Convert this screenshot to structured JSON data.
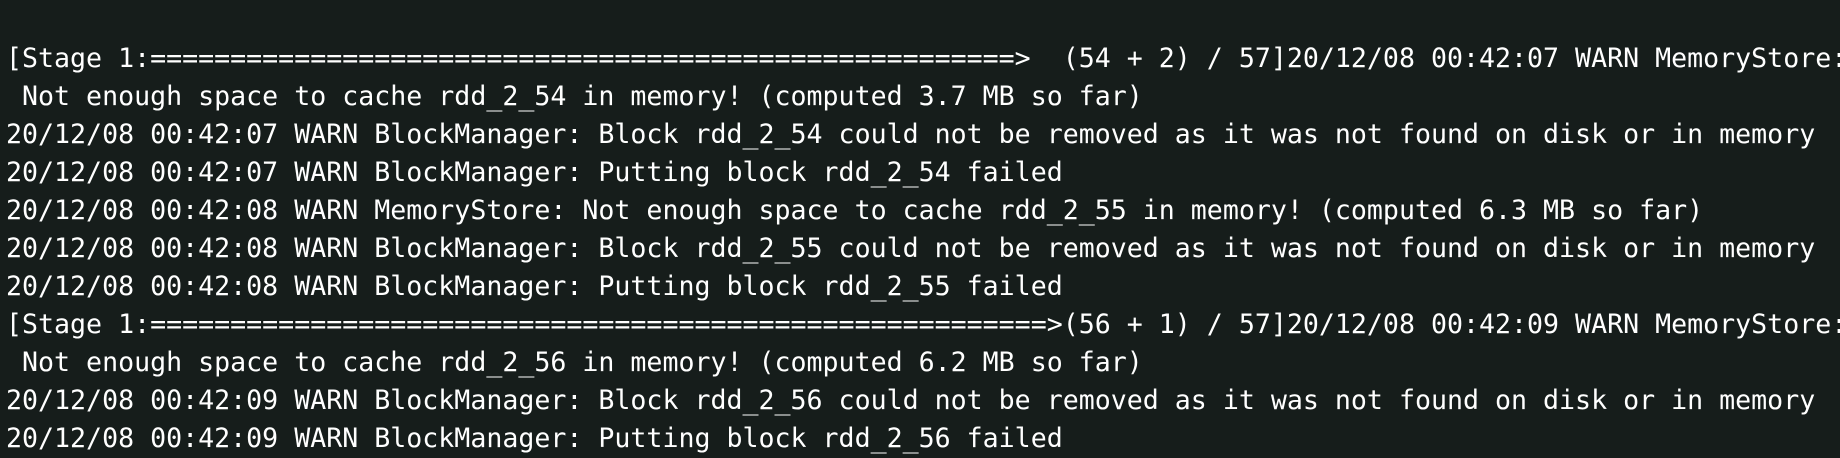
{
  "terminal": {
    "background": "#161d1b",
    "foreground": "#ffffff",
    "lines": [
      "[Stage 1:======================================================>  (54 + 2) / 57]20/12/08 00:42:07 WARN MemoryStore:",
      " Not enough space to cache rdd_2_54 in memory! (computed 3.7 MB so far)",
      "20/12/08 00:42:07 WARN BlockManager: Block rdd_2_54 could not be removed as it was not found on disk or in memory",
      "20/12/08 00:42:07 WARN BlockManager: Putting block rdd_2_54 failed",
      "20/12/08 00:42:08 WARN MemoryStore: Not enough space to cache rdd_2_55 in memory! (computed 6.3 MB so far)",
      "20/12/08 00:42:08 WARN BlockManager: Block rdd_2_55 could not be removed as it was not found on disk or in memory",
      "20/12/08 00:42:08 WARN BlockManager: Putting block rdd_2_55 failed",
      "[Stage 1:========================================================>(56 + 1) / 57]20/12/08 00:42:09 WARN MemoryStore:",
      " Not enough space to cache rdd_2_56 in memory! (computed 6.2 MB so far)",
      "20/12/08 00:42:09 WARN BlockManager: Block rdd_2_56 could not be removed as it was not found on disk or in memory",
      "20/12/08 00:42:09 WARN BlockManager: Putting block rdd_2_56 failed"
    ]
  }
}
